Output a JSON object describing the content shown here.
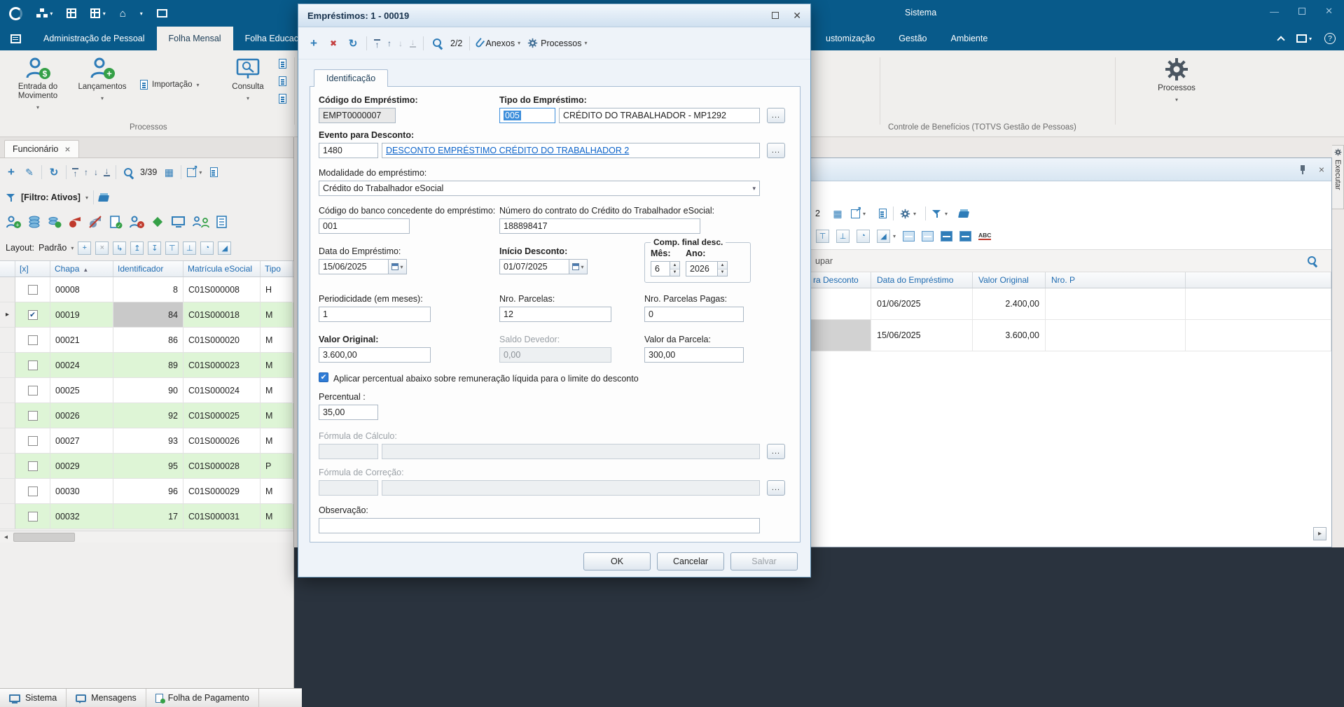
{
  "colors": {
    "titlebar_blue": "#085a8a",
    "accent_blue": "#2e7cb8",
    "row_green": "#def5d6",
    "link_blue": "#0a62c9",
    "selection_blue": "#3d8edb",
    "delete_red": "#c43f3f",
    "dark_workspace": "#2a333e"
  },
  "titlebar": {
    "system_menu": "Sistema"
  },
  "menubar": {
    "tabs": [
      {
        "label": "Administração de Pessoal"
      },
      {
        "label": "Folha Mensal"
      },
      {
        "label": "Folha Educacion"
      }
    ],
    "right_tabs": [
      {
        "label": "ustomização"
      },
      {
        "label": "Gestão"
      },
      {
        "label": "Ambiente"
      }
    ]
  },
  "ribbon": {
    "entrada_label": "Entrada do Movimento",
    "lancamentos_label": "Lançamentos",
    "importacao_label": "Importação",
    "consulta_label": "Consulta",
    "group_label": "Processos",
    "processos_label": "Processos",
    "right_group_label": "Controle de Benefícios (TOTVS Gestão de Pessoas)"
  },
  "left_panel": {
    "tab_label": "Funcionário",
    "pager": "3/39",
    "filter_label": "[Filtro: Ativos]",
    "layout_label": "Layout:",
    "layout_value": "Padrão",
    "columns": {
      "check": "[x]",
      "chapa": "Chapa",
      "ident": "Identificador",
      "matricula": "Matrícula eSocial",
      "tipo": "Tipo"
    },
    "rows": [
      {
        "chapa": "00008",
        "ident": "8",
        "matricula": "C01S000008",
        "tipo": "H"
      },
      {
        "chapa": "00019",
        "ident": "84",
        "matricula": "C01S000018",
        "tipo": "M"
      },
      {
        "chapa": "00021",
        "ident": "86",
        "matricula": "C01S000020",
        "tipo": "M"
      },
      {
        "chapa": "00024",
        "ident": "89",
        "matricula": "C01S000023",
        "tipo": "M"
      },
      {
        "chapa": "00025",
        "ident": "90",
        "matricula": "C01S000024",
        "tipo": "M"
      },
      {
        "chapa": "00026",
        "ident": "92",
        "matricula": "C01S000025",
        "tipo": "M"
      },
      {
        "chapa": "00027",
        "ident": "93",
        "matricula": "C01S000026",
        "tipo": "M"
      },
      {
        "chapa": "00029",
        "ident": "95",
        "matricula": "C01S000028",
        "tipo": "P"
      },
      {
        "chapa": "00030",
        "ident": "96",
        "matricula": "C01S000029",
        "tipo": "M"
      },
      {
        "chapa": "00032",
        "ident": "17",
        "matricula": "C01S000031",
        "tipo": "M"
      }
    ]
  },
  "statusbar": {
    "items": [
      {
        "label": "Sistema"
      },
      {
        "label": "Mensagens"
      },
      {
        "label": "Folha de Pagamento"
      }
    ]
  },
  "modal": {
    "title": "Empréstimos: 1 - 00019",
    "pager": "2/2",
    "anexos_label": "Anexos",
    "processos_label": "Processos",
    "tab_label": "Identificação",
    "browse_label": "...",
    "codigo_label": "Código do Empréstimo:",
    "codigo_value": "EMPT0000007",
    "tipo_label": "Tipo do Empréstimo:",
    "tipo_code": "005",
    "tipo_desc": "CRÉDITO DO TRABALHADOR - MP1292",
    "evento_label": "Evento para Desconto:",
    "evento_code": "1480",
    "evento_desc": "DESCONTO EMPRÉSTIMO CRÉDITO DO TRABALHADOR 2",
    "modalidade_label": "Modalidade do empréstimo:",
    "modalidade_value": "Crédito do Trabalhador eSocial",
    "banco_label": "Código do banco concedente do empréstimo:",
    "banco_value": "001",
    "contrato_label": "Número do contrato do Crédito do Trabalhador eSocial:",
    "contrato_value": "188898417",
    "data_emprestimo_label": "Data do Empréstimo:",
    "data_emprestimo_value": "15/06/2025",
    "inicio_desconto_label": "Início Desconto:",
    "inicio_desconto_value": "01/07/2025",
    "comp_final_label": "Comp. final desc.",
    "mes_label": "Mês:",
    "mes_value": "6",
    "ano_label": "Ano:",
    "ano_value": "2026",
    "periodicidade_label": "Periodicidade (em meses):",
    "periodicidade_value": "1",
    "nro_parcelas_label": "Nro. Parcelas:",
    "nro_parcelas_value": "12",
    "parcelas_pagas_label": "Nro. Parcelas Pagas:",
    "parcelas_pagas_value": "0",
    "valor_original_label": "Valor Original:",
    "valor_original_value": "3.600,00",
    "saldo_devedor_label": "Saldo Devedor:",
    "saldo_devedor_value": "0,00",
    "valor_parcela_label": "Valor da Parcela:",
    "valor_parcela_value": "300,00",
    "aplicar_percentual_label": "Aplicar percentual abaixo sobre remuneração líquida para o limite do desconto",
    "percentual_label": "Percentual :",
    "percentual_value": "35,00",
    "formula_calculo_label": "Fórmula de Cálculo:",
    "formula_correcao_label": "Fórmula de Correção:",
    "observacao_label": "Observação:",
    "ok": "OK",
    "cancelar": "Cancelar",
    "salvar": "Salvar"
  },
  "right_panel": {
    "pager_fragment": "2",
    "group_fragment": "upar",
    "abc_icon_text": "ABC",
    "columns": {
      "evento": "ra Desconto",
      "data": "Data do Empréstimo",
      "valor": "Valor Original",
      "nro": "Nro. P"
    },
    "rows": [
      {
        "data": "01/06/2025",
        "valor": "2.400,00"
      },
      {
        "data": "15/06/2025",
        "valor": "3.600,00"
      }
    ],
    "executar_label": "Executar"
  }
}
